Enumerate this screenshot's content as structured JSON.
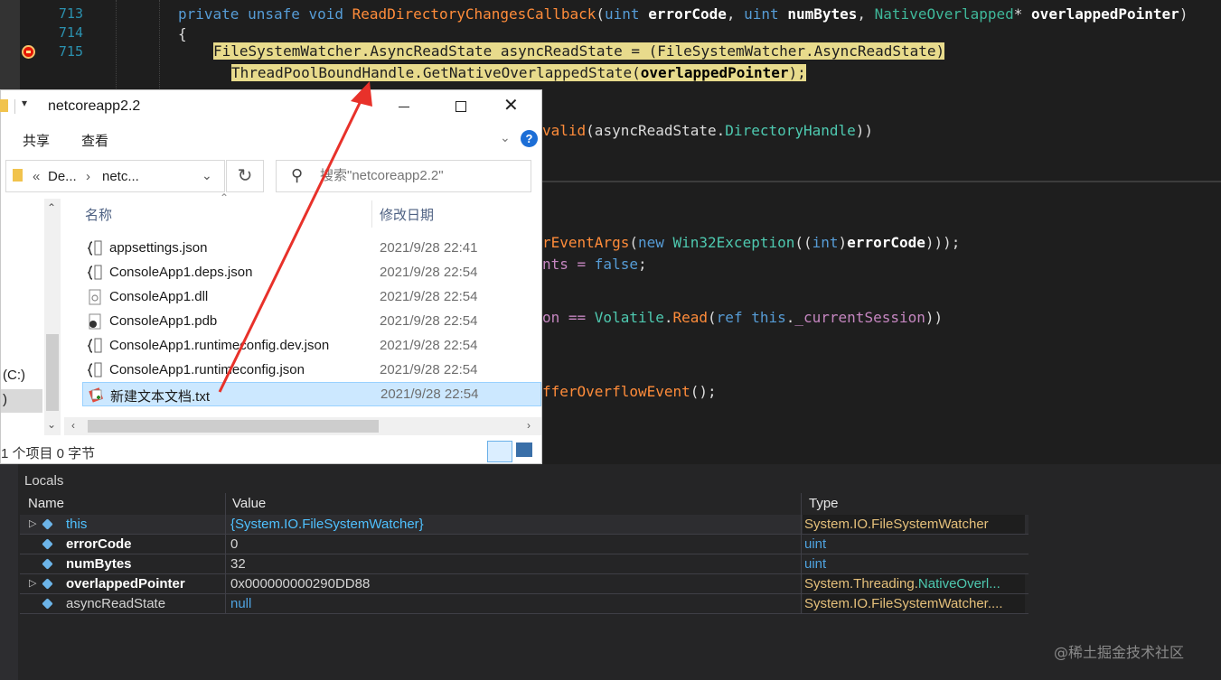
{
  "editor": {
    "line_numbers": [
      "713",
      "714",
      "715"
    ],
    "code_lines": {
      "l713": {
        "kw1": "private unsafe void ",
        "method": "ReadDirectoryChangesCallback",
        "p_open": "(",
        "kw_uint1": "uint ",
        "param1": "errorCode",
        "comma1": ", ",
        "kw_uint2": "uint ",
        "param2": "numBytes",
        "comma2": ", ",
        "type_no": "NativeOverlapped",
        "star": "* ",
        "param3": "overlappedPointer",
        "p_close": ")"
      },
      "l714": {
        "brace": "{"
      },
      "l715a": "FileSystemWatcher.AsyncReadState asyncReadState = (FileSystemWatcher.AsyncReadState)",
      "l716": {
        "call": "ThreadPoolBoundHandle.GetNativeOverlappedState(",
        "arg": "overlappedPointer",
        "end": ");"
      },
      "l_valid": {
        "fn": "valid",
        "rest": "(asyncReadState.",
        "prop": "DirectoryHandle",
        "end": "))"
      },
      "l_args": {
        "fn": "rEventArgs",
        "p": "(",
        "kw_new": "new ",
        "ty": "Win32Exception",
        "mid": "((",
        "kw_int": "int",
        "close": ")",
        "pm": "errorCode",
        "end": ")));"
      },
      "l_false": {
        "name": "nts = ",
        "kw_false": "false",
        "end": ";"
      },
      "l_session": {
        "name": "on == ",
        "ty": "Volatile",
        "dot": ".",
        "fn": "Read",
        "p": "(",
        "kw_ref": "ref ",
        "kw_this": "this",
        "dot2": ".",
        "fld": "_currentSession",
        "end": "))"
      },
      "l_overflow": {
        "fn": "fferOverflowEvent",
        "end": "();"
      }
    }
  },
  "explorer": {
    "title": "netcoreapp2.2",
    "ribbon_tabs": [
      "共享",
      "查看"
    ],
    "help_glyph": "?",
    "address": {
      "part1": "De...",
      "part2": "netc...",
      "prefix": "«",
      "sep": "›"
    },
    "search_placeholder": "搜索\"netcoreapp2.2\"",
    "columns": {
      "name": "名称",
      "date": "修改日期"
    },
    "nav_items": [
      "(C:)",
      ")"
    ],
    "files": [
      {
        "name": "appsettings.json",
        "date": "2021/9/28 22:41",
        "icon": "json-file-icon"
      },
      {
        "name": "ConsoleApp1.deps.json",
        "date": "2021/9/28 22:54",
        "icon": "json-file-icon"
      },
      {
        "name": "ConsoleApp1.dll",
        "date": "2021/9/28 22:54",
        "icon": "dll-file-icon"
      },
      {
        "name": "ConsoleApp1.pdb",
        "date": "2021/9/28 22:54",
        "icon": "pdb-file-icon"
      },
      {
        "name": "ConsoleApp1.runtimeconfig.dev.json",
        "date": "2021/9/28 22:54",
        "icon": "json-file-icon"
      },
      {
        "name": "ConsoleApp1.runtimeconfig.json",
        "date": "2021/9/28 22:54",
        "icon": "json-file-icon"
      },
      {
        "name": "新建文本文档.txt",
        "date": "2021/9/28 22:54",
        "icon": "txt-file-icon"
      }
    ],
    "status": "1 个项目  0 字节"
  },
  "locals": {
    "title": "Locals",
    "headers": {
      "name": "Name",
      "value": "Value",
      "type": "Type"
    },
    "rows": [
      {
        "name": "this",
        "value": "{System.IO.FileSystemWatcher}",
        "type": "System.IO.FileSystemWatcher",
        "expandable": true
      },
      {
        "name": "errorCode",
        "value": "0",
        "type": "uint",
        "expandable": false
      },
      {
        "name": "numBytes",
        "value": "32",
        "type": "uint",
        "expandable": false
      },
      {
        "name": "overlappedPointer",
        "value": "0x000000000290DD88",
        "type_a": "System.Threading.",
        "type_b": "NativeOverl...",
        "expandable": true
      },
      {
        "name": "asyncReadState",
        "value": "null",
        "type": "System.IO.FileSystemWatcher....",
        "expandable": false
      }
    ]
  },
  "watermark": "@稀土掘金技术社区",
  "colors": {
    "editor_bg": "#1e1e1e",
    "keyword": "#569cd6",
    "method": "#ff8c3a",
    "type": "#4ec9b0",
    "highlight": "#e8db8c",
    "arrow": "#e8312a",
    "type_yellow": "#e5c07b",
    "value_blue": "#4fc1ff"
  }
}
